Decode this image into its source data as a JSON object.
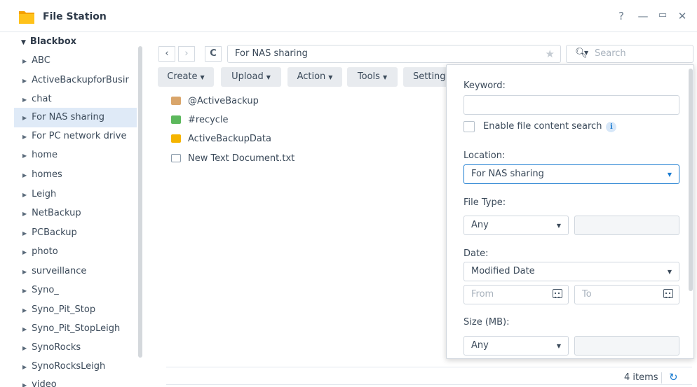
{
  "window": {
    "title": "File Station",
    "help": "?",
    "minimize": "—",
    "maximize": "▭",
    "close": "✕"
  },
  "sidebar": {
    "root": "Blackbox",
    "items": [
      {
        "label": "ABC"
      },
      {
        "label": "ActiveBackupforBusir"
      },
      {
        "label": "chat"
      },
      {
        "label": "For NAS sharing"
      },
      {
        "label": "For PC network drive"
      },
      {
        "label": "home"
      },
      {
        "label": "homes"
      },
      {
        "label": "Leigh"
      },
      {
        "label": "NetBackup"
      },
      {
        "label": "PCBackup"
      },
      {
        "label": "photo"
      },
      {
        "label": "surveillance"
      },
      {
        "label": "Syno_"
      },
      {
        "label": "Syno_Pit_Stop"
      },
      {
        "label": "Syno_Pit_StopLeigh"
      },
      {
        "label": "SynoRocks"
      },
      {
        "label": "SynoRocksLeigh"
      },
      {
        "label": "video"
      }
    ]
  },
  "toolbar": {
    "back": "‹",
    "forward": "›",
    "refresh": "C",
    "path": "For NAS sharing",
    "star": "★",
    "search_placeholder": "Search",
    "create": "Create",
    "upload": "Upload",
    "action": "Action",
    "tools": "Tools",
    "settings": "Setting"
  },
  "files": [
    {
      "name": "@ActiveBackup",
      "icon": "folder-special-icon",
      "color": "#d9a56a"
    },
    {
      "name": "#recycle",
      "icon": "recycle-folder-icon",
      "color": "#5cb85c"
    },
    {
      "name": "ActiveBackupData",
      "icon": "folder-icon",
      "color": "#f5b400"
    },
    {
      "name": "New Text Document.txt",
      "icon": "text-file-icon",
      "color": "#8a9aaa"
    }
  ],
  "status": {
    "items": "4 items"
  },
  "search_panel": {
    "keyword_label": "Keyword:",
    "keyword_value": "",
    "content_search_label": "Enable file content search",
    "location_label": "Location:",
    "location_value": "For NAS sharing",
    "filetype_label": "File Type:",
    "filetype_value": "Any",
    "date_label": "Date:",
    "date_value": "Modified Date",
    "from_placeholder": "From",
    "to_placeholder": "To",
    "size_label": "Size (MB):",
    "size_value": "Any"
  },
  "colors": {
    "accent": "#1a7bd0",
    "selected_bg": "#dfeaf7",
    "folder": "#f5b400"
  }
}
